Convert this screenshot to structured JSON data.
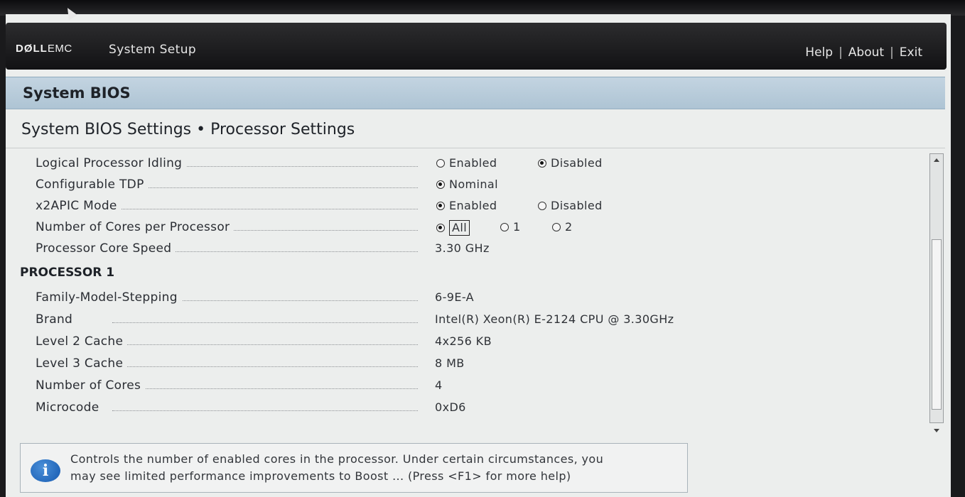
{
  "header": {
    "brand_dell": "DØLL",
    "brand_emc": "EMC",
    "app_title": "System Setup",
    "links": [
      "Help",
      "About",
      "Exit"
    ],
    "separator": "|"
  },
  "section": {
    "title": "System BIOS"
  },
  "page": {
    "title": "System BIOS Settings • Processor Settings"
  },
  "settings": {
    "logical_processor_idling": {
      "label": "Logical Processor Idling",
      "options": [
        "Enabled",
        "Disabled"
      ],
      "selected": "Disabled"
    },
    "configurable_tdp": {
      "label": "Configurable TDP",
      "options": [
        "Nominal"
      ],
      "selected": "Nominal"
    },
    "x2apic_mode": {
      "label": "x2APIC Mode",
      "options": [
        "Enabled",
        "Disabled"
      ],
      "selected": "Enabled"
    },
    "cores_per_processor": {
      "label": "Number of Cores per Processor",
      "options": [
        "All",
        "1",
        "2"
      ],
      "selected": "All"
    },
    "core_speed": {
      "label": "Processor Core Speed",
      "value": "3.30 GHz"
    }
  },
  "processor": {
    "heading": "PROCESSOR 1",
    "rows": [
      {
        "label": "Family-Model-Stepping",
        "value": "6-9E-A"
      },
      {
        "label": "Brand",
        "value": "Intel(R) Xeon(R) E-2124 CPU @ 3.30GHz"
      },
      {
        "label": "Level 2 Cache",
        "value": "4x256 KB"
      },
      {
        "label": "Level 3 Cache",
        "value": "8 MB"
      },
      {
        "label": "Number of Cores",
        "value": "4"
      },
      {
        "label": "Microcode",
        "value": "0xD6"
      }
    ]
  },
  "help": {
    "line1": "Controls the number of enabled cores in the processor. Under certain circumstances, you",
    "line2": "may see limited performance improvements to Boost ... (Press <F1> for more help)",
    "icon": "info-icon"
  }
}
